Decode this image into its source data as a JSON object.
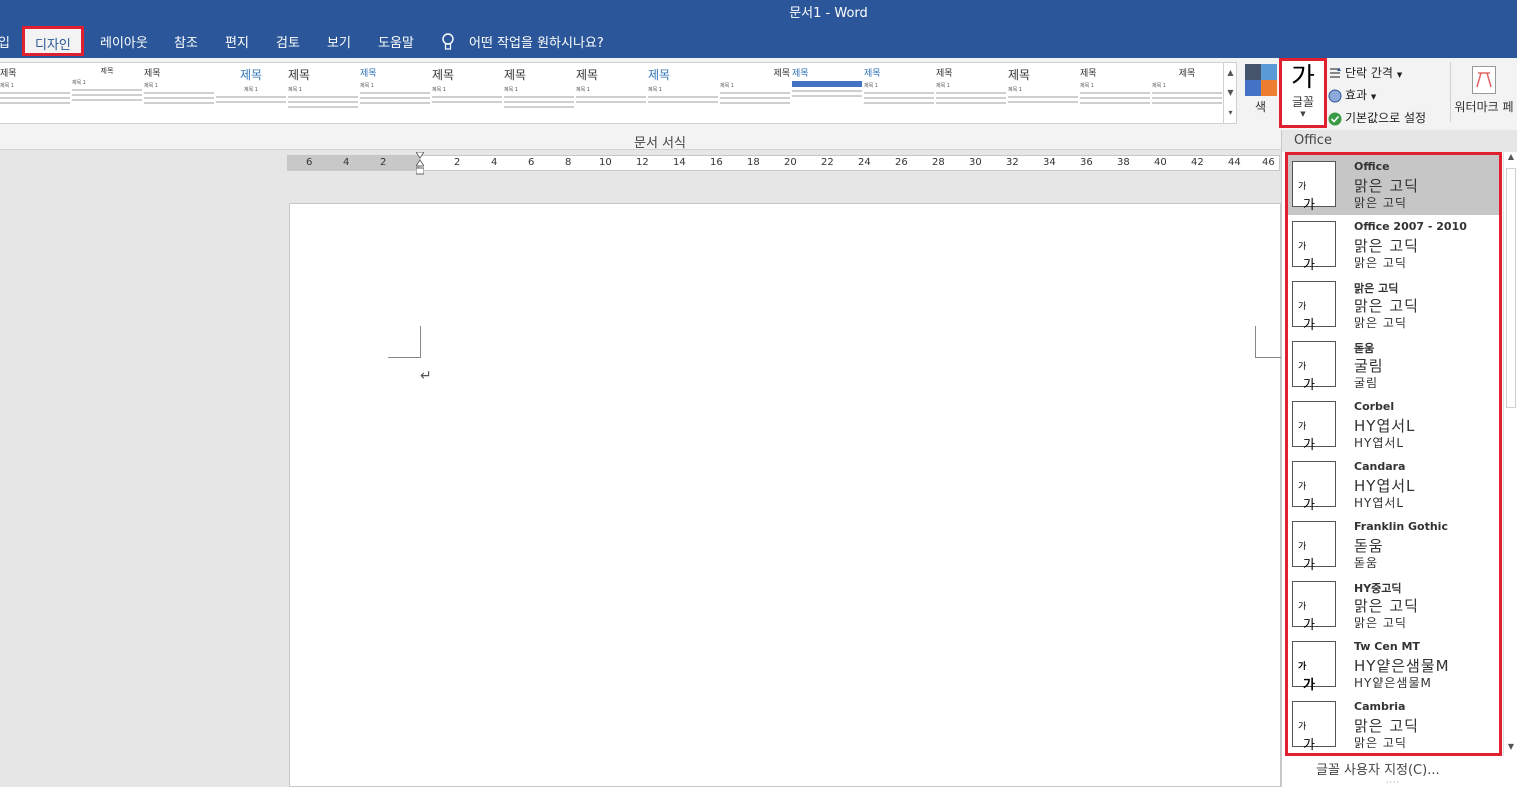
{
  "window": {
    "title": "문서1  -  Word"
  },
  "tabs": [
    {
      "id": "insert",
      "label": "입"
    },
    {
      "id": "design",
      "label": "디자인"
    },
    {
      "id": "layout",
      "label": "레이아웃"
    },
    {
      "id": "references",
      "label": "참조"
    },
    {
      "id": "mailings",
      "label": "편지"
    },
    {
      "id": "review",
      "label": "검토"
    },
    {
      "id": "view",
      "label": "보기"
    },
    {
      "id": "help",
      "label": "도움말"
    }
  ],
  "tell_me": {
    "label": "어떤 작업을 원하시나요?"
  },
  "ribbon": {
    "gallery_group_label": "문서 서식",
    "thumb_title": "제목",
    "thumb_heading": "제목 1",
    "colors_label": "색",
    "fonts_button_glyph": "가",
    "fonts_label": "글꼴",
    "paragraph_spacing_label": "단락 간격",
    "effects_label": "효과",
    "set_default_label": "기본값으로 설정",
    "watermark_label": "워터마크 페",
    "colors": {
      "blue": "#4472c4",
      "gray": "#44546a",
      "orange": "#ed7d31",
      "lightblue": "#5b9bd5"
    }
  },
  "ruler": {
    "ticks": [
      "6",
      "4",
      "2",
      "2",
      "4",
      "6",
      "8",
      "10",
      "12",
      "14",
      "16",
      "18",
      "20",
      "22",
      "24",
      "26",
      "28",
      "30",
      "32",
      "34",
      "36",
      "38",
      "40",
      "42",
      "44",
      "46"
    ]
  },
  "document": {
    "paragraph_mark": "↵"
  },
  "font_dropdown": {
    "section_header": "Office",
    "preview_glyph": "가",
    "preview_glyph_small": "가",
    "items": [
      {
        "name": "Office",
        "heading_font": "맑은 고딕",
        "body_font": "맑은 고딕",
        "selected": true
      },
      {
        "name": "Office 2007 - 2010",
        "heading_font": "맑은 고딕",
        "body_font": "맑은 고딕"
      },
      {
        "name": "맑은 고딕",
        "heading_font": "맑은 고딕",
        "body_font": "맑은 고딕"
      },
      {
        "name": "돋움",
        "heading_font": "굴림",
        "body_font": "굴림"
      },
      {
        "name": "Corbel",
        "heading_font": "HY엽서L",
        "body_font": "HY엽서L"
      },
      {
        "name": "Candara",
        "heading_font": "HY엽서L",
        "body_font": "HY엽서L"
      },
      {
        "name": "Franklin Gothic",
        "heading_font": "돋움",
        "body_font": "돋움"
      },
      {
        "name": "HY중고딕",
        "heading_font": "맑은 고딕",
        "body_font": "맑은 고딕"
      },
      {
        "name": "Tw Cen MT",
        "heading_font": "HY얕은샘물M",
        "body_font": "HY얕은샘물M"
      },
      {
        "name": "Cambria",
        "heading_font": "맑은 고딕",
        "body_font": "맑은 고딕"
      }
    ],
    "customize_label": "글꼴 사용자 지정(C)...",
    "grip": "····"
  },
  "accent_colors": {
    "titlebar": "#2b579a",
    "highlight_border": "#e0202e"
  }
}
